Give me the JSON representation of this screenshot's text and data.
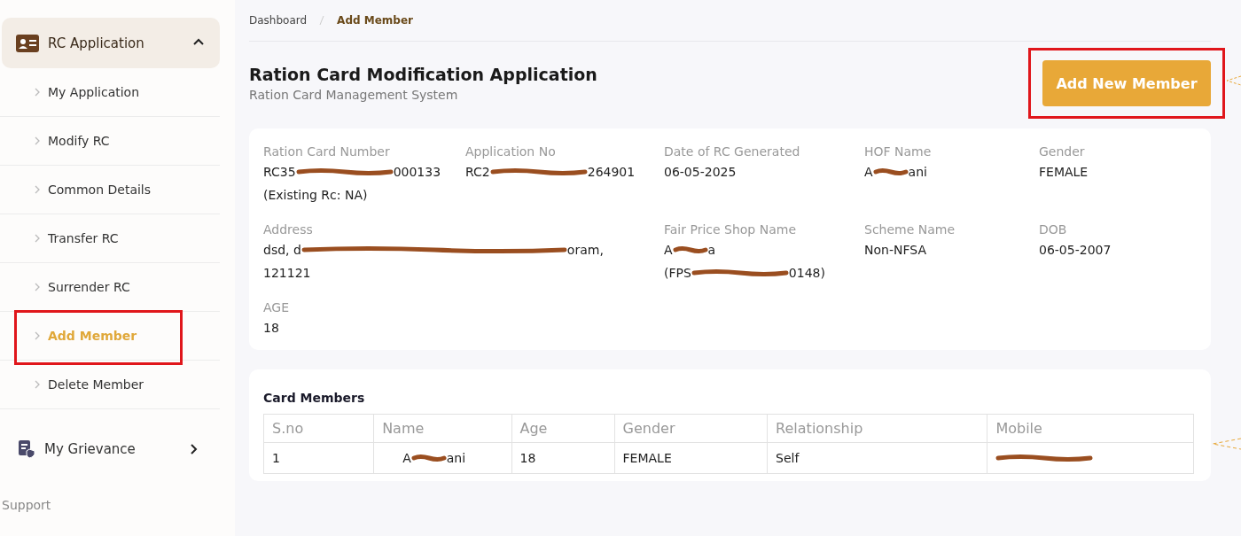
{
  "sidebar": {
    "group": {
      "label": "RC Application",
      "expanded": true,
      "items": [
        {
          "label": "My Application",
          "selected": false,
          "highlighted": false
        },
        {
          "label": "Modify RC",
          "selected": false,
          "highlighted": false
        },
        {
          "label": "Common Details",
          "selected": false,
          "highlighted": false
        },
        {
          "label": "Transfer RC",
          "selected": false,
          "highlighted": false
        },
        {
          "label": "Surrender RC",
          "selected": false,
          "highlighted": false
        },
        {
          "label": "Add Member",
          "selected": true,
          "highlighted": true
        },
        {
          "label": "Delete Member",
          "selected": false,
          "highlighted": false
        }
      ]
    },
    "grievance": {
      "label": "My Grievance",
      "expanded": false
    },
    "support": "Support"
  },
  "breadcrumb": [
    {
      "label": "Dashboard",
      "selected": false
    },
    {
      "label": "Add Member",
      "selected": true
    }
  ],
  "header": {
    "title": "Ration Card Modification Application",
    "subtitle": "Ration Card Management System",
    "button": {
      "label": "Add New Member",
      "highlighted": true
    }
  },
  "details": [
    {
      "label": "Ration Card Number",
      "value": [
        {
          "kind": "text",
          "text": "RC35"
        },
        {
          "kind": "redaction-medium"
        },
        {
          "kind": "text",
          "text": "000133"
        }
      ],
      "extra": [
        {
          "kind": "text",
          "text": "(Existing Rc: NA)"
        }
      ],
      "wide": false
    },
    {
      "label": "Application No",
      "value": [
        {
          "kind": "text",
          "text": "RC2"
        },
        {
          "kind": "redaction-medium"
        },
        {
          "kind": "text",
          "text": "264901"
        }
      ],
      "wide": false
    },
    {
      "label": "Date of RC Generated",
      "value": [
        {
          "kind": "text",
          "text": "06-05-2025"
        }
      ],
      "wide": false
    },
    {
      "label": "HOF Name",
      "value": [
        {
          "kind": "text",
          "text": "A"
        },
        {
          "kind": "redaction-short"
        },
        {
          "kind": "text",
          "text": "ani"
        }
      ],
      "wide": false
    },
    {
      "label": "Gender",
      "value": [
        {
          "kind": "text",
          "text": "FEMALE"
        }
      ],
      "wide": false
    },
    {
      "label": "Address",
      "value": [
        {
          "kind": "text",
          "text": "dsd, d"
        },
        {
          "kind": "redaction-long"
        },
        {
          "kind": "text",
          "text": "oram,"
        }
      ],
      "extra": [
        {
          "kind": "text",
          "text": "121121"
        }
      ],
      "wide": true
    },
    {
      "label": "Fair Price Shop Name",
      "value": [
        {
          "kind": "text",
          "text": "A"
        },
        {
          "kind": "redaction-short"
        },
        {
          "kind": "text",
          "text": "a"
        }
      ],
      "extra": [
        {
          "kind": "text",
          "text": "(FPS"
        },
        {
          "kind": "redaction-medium"
        },
        {
          "kind": "text",
          "text": "0148)"
        }
      ],
      "wide": false
    },
    {
      "label": "Scheme Name",
      "value": [
        {
          "kind": "text",
          "text": "Non-NFSA"
        }
      ],
      "wide": false
    },
    {
      "label": "DOB",
      "value": [
        {
          "kind": "text",
          "text": "06-05-2007"
        }
      ],
      "wide": false
    },
    {
      "label": "AGE",
      "value": [
        {
          "kind": "text",
          "text": "18"
        }
      ],
      "wide": false
    }
  ],
  "members": {
    "title": "Card Members",
    "columns": [
      "S.no",
      "Name",
      "Age",
      "Gender",
      "Relationship",
      "Mobile"
    ],
    "rows": [
      [
        [
          {
            "kind": "text",
            "text": "1"
          }
        ],
        [
          {
            "kind": "text",
            "text": "A"
          },
          {
            "kind": "redaction-short"
          },
          {
            "kind": "text",
            "text": "ani"
          }
        ],
        [
          {
            "kind": "text",
            "text": "18"
          }
        ],
        [
          {
            "kind": "text",
            "text": "FEMALE"
          }
        ],
        [
          {
            "kind": "text",
            "text": "Self"
          }
        ],
        [
          {
            "kind": "redaction-medium"
          }
        ]
      ]
    ]
  }
}
